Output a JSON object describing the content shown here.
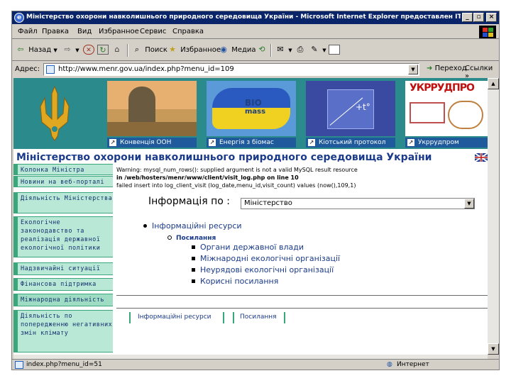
{
  "window": {
    "title": "Міністерство охорони навколишнього природного середовища України - Microsoft Internet Explorer предоставлен ITware",
    "min_label": "_",
    "max_label": "▫",
    "close_label": "×"
  },
  "menu": [
    "Файл",
    "Правка",
    "Вид",
    "Избранное",
    "Сервис",
    "Справка"
  ],
  "toolbar": {
    "back": "Назад",
    "search": "Поиск",
    "favorites": "Избранное",
    "media": "Медиа"
  },
  "address": {
    "label": "Адрес:",
    "url": "http://www.menr.gov.ua/index.php?menu_id=109",
    "go": "Переход",
    "links": "Ссылки"
  },
  "banner": {
    "promos": [
      "Конвенція ООН",
      "Енергія з біомас",
      "Кіотський протокол",
      "Укррудпром"
    ],
    "biomass_text_1": "BIO",
    "biomass_text_2": "mass",
    "ukrrudprom_logo": "УКРРУДПРО"
  },
  "heading": "Міністерство охорони навколишнього природного середовища України",
  "nav": [
    "Колонка Міністра",
    "Новини на веб-порталі",
    "Діяльність Міністерства",
    "Екологічне законодавство та реалізація державної екологічної політики",
    "Надзвичайні ситуації",
    "Фінансова підтримка",
    "Міжнародна діяльність",
    "Діяльність по попередженню негативних змін клімату"
  ],
  "warning": {
    "line1": "Warning: mysql_num_rows(): supplied argument is not a valid MySQL result resource",
    "line2": "in /web/hosters/menr/www/client/visit_log.php on line 10",
    "line3": "failed insert into log_client_visit (log_date,menu_id,visit_count) values (now(),109,1)"
  },
  "info": {
    "label": "Інформація по :",
    "select_value": "Міністерство"
  },
  "tree": {
    "level1": "Інформаційні ресурси",
    "level2": "Посилання",
    "level3": [
      "Органи державної влади",
      "Міжнародні екологічні організації",
      "Неурядові екологічні організації",
      "Корисні посилання"
    ]
  },
  "bottom_links": [
    "Інформаційні ресурси",
    "Посилання"
  ],
  "status": {
    "url": "index.php?menu_id=51",
    "zone": "Интернет"
  },
  "colors": {
    "banner": "#2a8a8c",
    "nav_bg": "#b9e8d6",
    "nav_border": "#3aa67c",
    "heading": "#1a3a8a"
  }
}
